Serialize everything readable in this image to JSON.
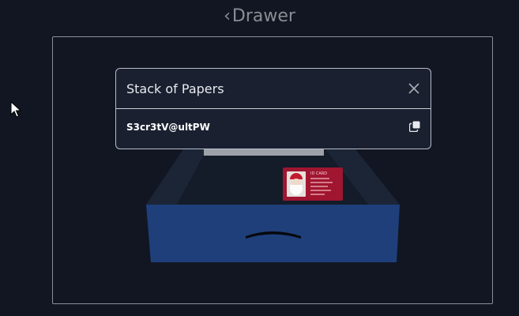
{
  "header": {
    "back_chevron": "‹",
    "title": "Drawer"
  },
  "modal": {
    "title": "Stack of Papers",
    "close_icon": "close-icon",
    "content": "S3cr3tV@ultPW",
    "copy_icon": "copy-icon"
  },
  "scene": {
    "id_card_title": "ID CARD"
  },
  "colors": {
    "background": "#111622",
    "drawer_front": "#1f3f7a",
    "drawer_inner": "#1a2334",
    "id_card": "#a01530",
    "modal_bg": "#1a2030"
  }
}
